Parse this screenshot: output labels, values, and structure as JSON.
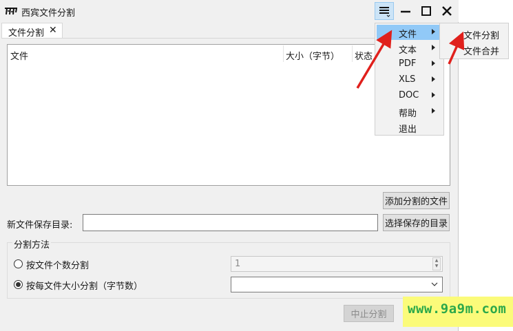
{
  "window": {
    "title": "西宾文件分割",
    "controls": {
      "menu_icon": "hamburger-menu-icon",
      "min_icon": "minimize-icon",
      "max_icon": "maximize-icon",
      "close_icon": "close-icon"
    }
  },
  "tab": {
    "label": "文件分割",
    "close_icon": "close-icon"
  },
  "file_list": {
    "columns": [
      {
        "label": "文件"
      },
      {
        "label": "大小（字节）"
      },
      {
        "label": "状态"
      }
    ]
  },
  "buttons": {
    "add_files": "添加分割的文件",
    "choose_dir": "选择保存的目录",
    "stop_split": "中止分割"
  },
  "save_dir": {
    "label": "新文件保存目录:",
    "value": ""
  },
  "split_method": {
    "title": "分割方法",
    "by_count": {
      "label": "按文件个数分割",
      "value": "1",
      "selected": false
    },
    "by_size": {
      "label": "按每文件大小分割（字节数）",
      "value": "",
      "selected": true
    }
  },
  "menu": {
    "items": [
      {
        "label": "文件",
        "has_submenu": true,
        "active": true
      },
      {
        "label": "文本",
        "has_submenu": true
      },
      {
        "label": "PDF",
        "has_submenu": true
      },
      {
        "label": "XLS",
        "has_submenu": true
      },
      {
        "label": "DOC",
        "has_submenu": true
      },
      {
        "label": "帮助",
        "has_submenu": true
      },
      {
        "label": "退出",
        "has_submenu": false
      }
    ],
    "submenu": [
      {
        "label": "文件分割"
      },
      {
        "label": "文件合并"
      }
    ]
  },
  "watermark": {
    "text": "www.9a9m.com"
  },
  "colors": {
    "menu_highlight": "#91c9f7",
    "arrow": "#e0201c",
    "watermark_bg": "#fbfb7a",
    "watermark_text": "#2ba84a"
  }
}
